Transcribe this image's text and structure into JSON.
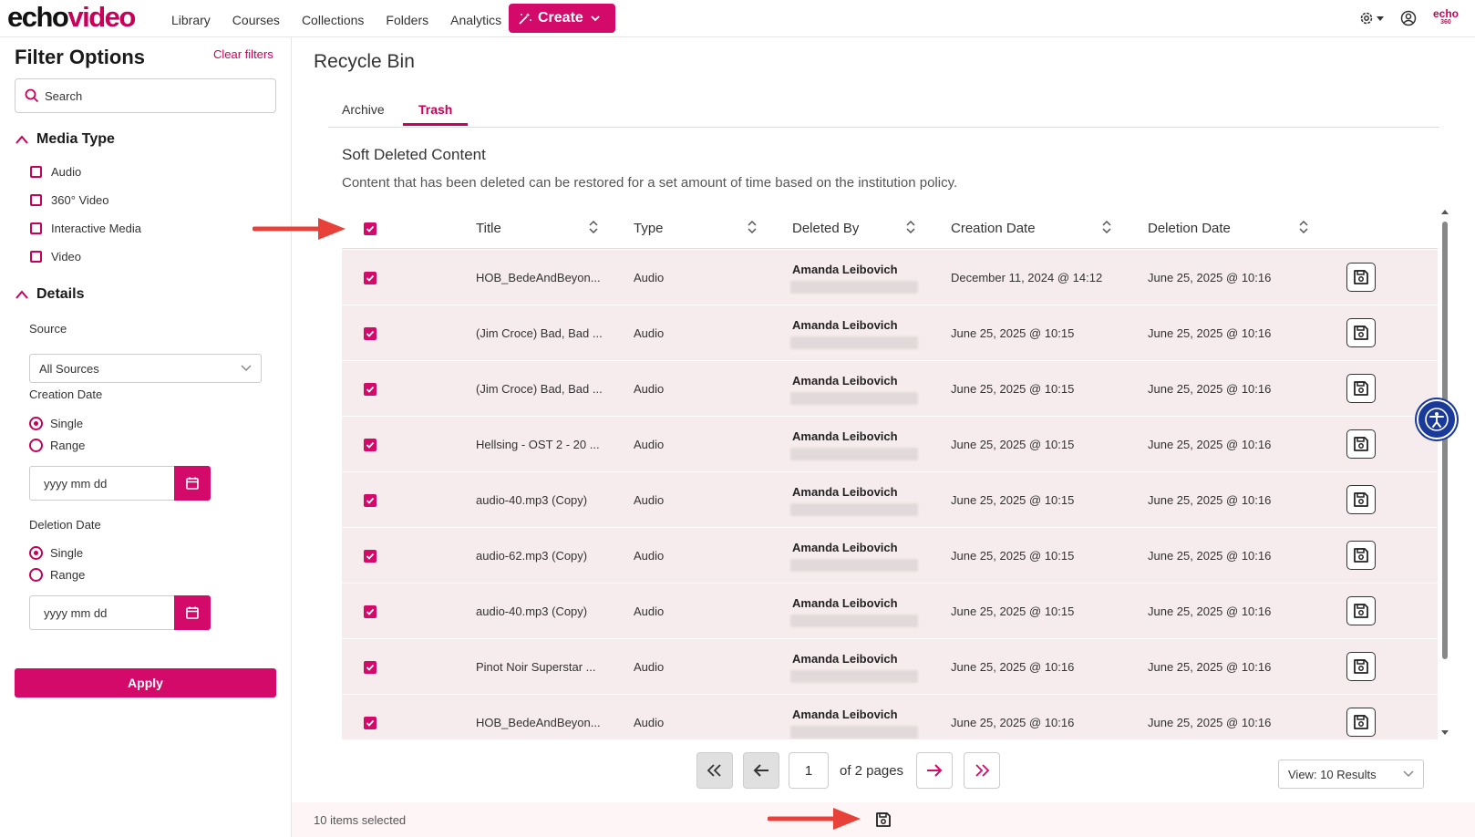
{
  "header": {
    "logo_part1": "echo",
    "logo_part2": "video",
    "nav": [
      "Library",
      "Courses",
      "Collections",
      "Folders",
      "Analytics"
    ],
    "create_label": "Create",
    "brand_mark": "echo",
    "brand_mark_sub": "360"
  },
  "sidebar": {
    "title": "Filter Options",
    "clear_filters": "Clear filters",
    "search_label": "Search",
    "media_type_heading": "Media Type",
    "media_types": [
      "Audio",
      "360° Video",
      "Interactive Media",
      "Video"
    ],
    "details_heading": "Details",
    "source_label": "Source",
    "source_value": "All Sources",
    "creation_date_label": "Creation Date",
    "deletion_date_label": "Deletion Date",
    "single_label": "Single",
    "range_label": "Range",
    "date_placeholder": "yyyy mm dd",
    "apply_label": "Apply"
  },
  "main": {
    "page_title": "Recycle Bin",
    "tabs": [
      "Archive",
      "Trash"
    ],
    "active_tab": "Trash",
    "section_title": "Soft Deleted Content",
    "section_desc": "Content that has been deleted can be restored for a set amount of time based on the institution policy.",
    "columns": [
      "Title",
      "Type",
      "Deleted By",
      "Creation Date",
      "Deletion Date"
    ],
    "rows": [
      {
        "title": "HOB_BedeAndBeyon...",
        "type": "Audio",
        "deleted_by": "Amanda Leibovich",
        "created": "December 11, 2024 @ 14:12",
        "deleted": "June 25, 2025 @ 10:16"
      },
      {
        "title": "(Jim Croce) Bad, Bad ...",
        "type": "Audio",
        "deleted_by": "Amanda Leibovich",
        "created": "June 25, 2025 @ 10:15",
        "deleted": "June 25, 2025 @ 10:16"
      },
      {
        "title": "(Jim Croce) Bad, Bad ...",
        "type": "Audio",
        "deleted_by": "Amanda Leibovich",
        "created": "June 25, 2025 @ 10:15",
        "deleted": "June 25, 2025 @ 10:16"
      },
      {
        "title": "Hellsing - OST 2 - 20 ...",
        "type": "Audio",
        "deleted_by": "Amanda Leibovich",
        "created": "June 25, 2025 @ 10:15",
        "deleted": "June 25, 2025 @ 10:16"
      },
      {
        "title": "audio-40.mp3 (Copy)",
        "type": "Audio",
        "deleted_by": "Amanda Leibovich",
        "created": "June 25, 2025 @ 10:15",
        "deleted": "June 25, 2025 @ 10:16"
      },
      {
        "title": "audio-62.mp3 (Copy)",
        "type": "Audio",
        "deleted_by": "Amanda Leibovich",
        "created": "June 25, 2025 @ 10:15",
        "deleted": "June 25, 2025 @ 10:16"
      },
      {
        "title": "audio-40.mp3 (Copy)",
        "type": "Audio",
        "deleted_by": "Amanda Leibovich",
        "created": "June 25, 2025 @ 10:15",
        "deleted": "June 25, 2025 @ 10:16"
      },
      {
        "title": "Pinot Noir Superstar ...",
        "type": "Audio",
        "deleted_by": "Amanda Leibovich",
        "created": "June 25, 2025 @ 10:16",
        "deleted": "June 25, 2025 @ 10:16"
      },
      {
        "title": "HOB_BedeAndBeyon...",
        "type": "Audio",
        "deleted_by": "Amanda Leibovich",
        "created": "June 25, 2025 @ 10:16",
        "deleted": "June 25, 2025 @ 10:16"
      }
    ]
  },
  "pagination": {
    "current_page": "1",
    "of_pages": "of 2 pages",
    "view_results": "View: 10 Results"
  },
  "footer": {
    "selected_text": "10 items selected"
  },
  "colors": {
    "accent": "#d40a6a",
    "row_bg": "#f7eced",
    "arrow": "#e8413a"
  }
}
